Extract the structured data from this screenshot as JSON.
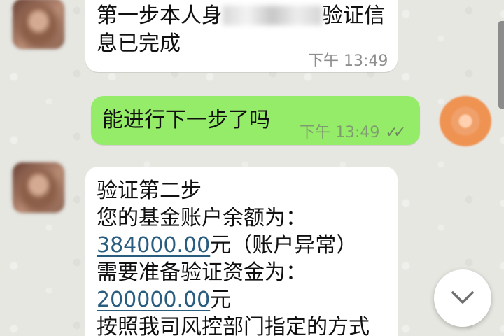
{
  "messages": {
    "first": {
      "line1_before": "第一步本人身",
      "line1_after": "验证信",
      "line2": "息已完成",
      "time": "下午 13:49"
    },
    "reply": {
      "text": "能进行下一步了吗",
      "time": "下午 13:49"
    },
    "second": {
      "line1": "验证第二步",
      "line2": "您的基金账户余额为：",
      "amount1": "384000.00",
      "line3_suffix": "元（账户异常）",
      "line4": "需要准备验证资金为：",
      "amount2": "200000.00",
      "line5_suffix": "元",
      "line6": "按照我司风控部门指定的方式"
    }
  },
  "icons": {
    "read_receipt": "double-check-icon",
    "scroll_down": "chevron-down-icon"
  },
  "colors": {
    "incoming_bubble": "#ffffff",
    "outgoing_bubble": "#95ec69",
    "amount_link": "#295d7f",
    "chat_background": "#e7e7e2"
  }
}
